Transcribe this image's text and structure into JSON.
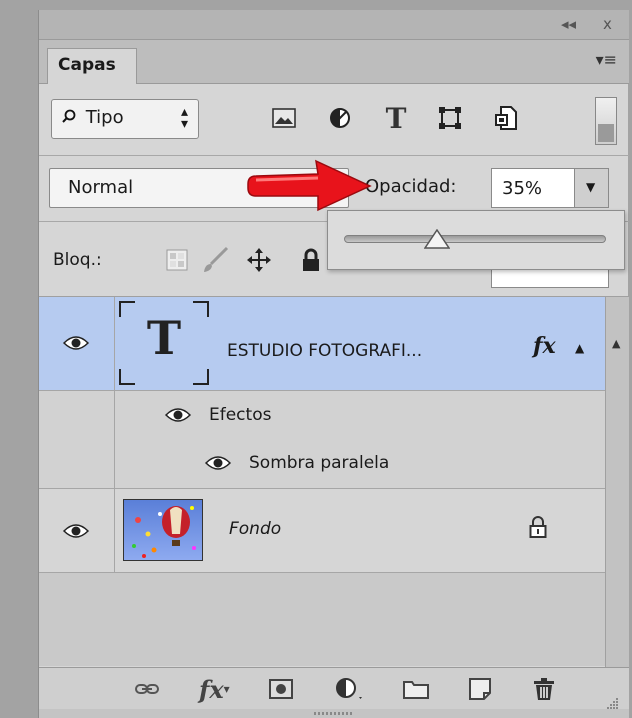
{
  "panel": {
    "tab_label": "Capas",
    "collapse_glyph": "◂◂",
    "close_glyph": "x"
  },
  "filter": {
    "kind_label": "Tipo"
  },
  "blend": {
    "mode": "Normal",
    "opacity_label": "Opacidad:",
    "opacity_value": "35%"
  },
  "lock": {
    "label": "Bloq.:"
  },
  "layers": [
    {
      "name": "ESTUDIO    FOTOGRAFI...",
      "fx": "fx",
      "effects_label": "Efectos",
      "effect_item": "Sombra paralela"
    },
    {
      "name": "Fondo"
    }
  ],
  "colors": {
    "selection": "#b6cbf0",
    "arrow": "#e8131b",
    "panel_bg": "#d6d6d6"
  },
  "icons": [
    "search-icon",
    "image-filter-icon",
    "adjustment-filter-icon",
    "type-filter-icon",
    "shape-filter-icon",
    "smart-object-filter-icon",
    "eye-icon",
    "lock-icon",
    "link-icon",
    "fx-icon",
    "mask-icon",
    "adjustment-layer-icon",
    "folder-icon",
    "new-layer-icon",
    "trash-icon",
    "move-icon",
    "brush-icon",
    "transparency-lock-icon"
  ]
}
